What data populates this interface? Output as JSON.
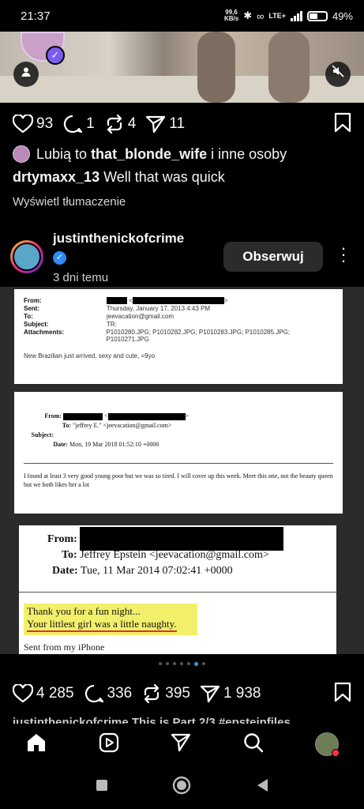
{
  "status_bar": {
    "time": "21:37",
    "net_speed_value": "99,6",
    "net_speed_unit": "KB/s",
    "network": "LTE+",
    "battery": "49%"
  },
  "previous_post": {
    "likes": "93",
    "comments": "1",
    "reposts": "4",
    "shares": "11",
    "liked_by_prefix": "Lubią to ",
    "liked_by_user": "that_blonde_wife",
    "liked_by_suffix": " i inne osoby",
    "caption_user": "drtymaxx_13",
    "caption_text": " Well that was quick",
    "translate_label": "Wyświetl tłumaczenie"
  },
  "post": {
    "username": "justinthenickofcrime",
    "time_ago": "3 dni temu",
    "follow_label": "Obserwuj",
    "likes": "4 285",
    "comments": "336",
    "reposts": "395",
    "shares": "1 938",
    "carousel_index": 6,
    "carousel_count": 9,
    "next_caption_peek": "justinthenickofcrime This is Part 2/3 #epsteinfiles"
  },
  "documents": {
    "doc1": {
      "from_label": "From:",
      "sent_label": "Sent:",
      "sent_value": "Thursday, January 17, 2013 4:43 PM",
      "to_label": "To:",
      "to_value": "jeevacation@gmail.com",
      "subject_label": "Subject:",
      "subject_value": "TR:",
      "attachments_label": "Attachments:",
      "attachments_value": "P1010280.JPG; P1010282.JPG; P1010283.JPG; P1010285.JPG; P1010271.JPG",
      "body": "New Brazilian just arrived, sexy and cute, =9yo"
    },
    "doc2": {
      "from_label": "From:",
      "to_label": "To:",
      "to_value": "\"jeffrey E.\" <jeevacation@gmail.com>",
      "subject_label": "Subject:",
      "date_label": "Date:",
      "date_value": "Mon, 19 Mar 2018 01:52:10 +0000",
      "body": "I found at least 3 very good young poor but we was so tired. I will cover up this week. Meet this one, not the beauty queen but we both likes her a lot"
    },
    "doc3": {
      "from_label": "From:",
      "to_label": "To:",
      "to_value": "Jeffrey Epstein <jeevacation@gmail.com>",
      "date_label": "Date:",
      "date_value": "Tue, 11 Mar 2014 07:02:41 +0000",
      "line1": "Thank you for a fun night...",
      "line2": "Your littlest girl was a little naughty.",
      "sent_from": "Sent from my iPhone"
    }
  },
  "colors": {
    "background": "#000000",
    "verified_blue": "#2f8cf6",
    "follow_button_bg": "#2b2b2b",
    "carousel_active_dot": "#3897f0",
    "highlight_yellow": "#f2f06a",
    "underline_red": "#e03030"
  }
}
